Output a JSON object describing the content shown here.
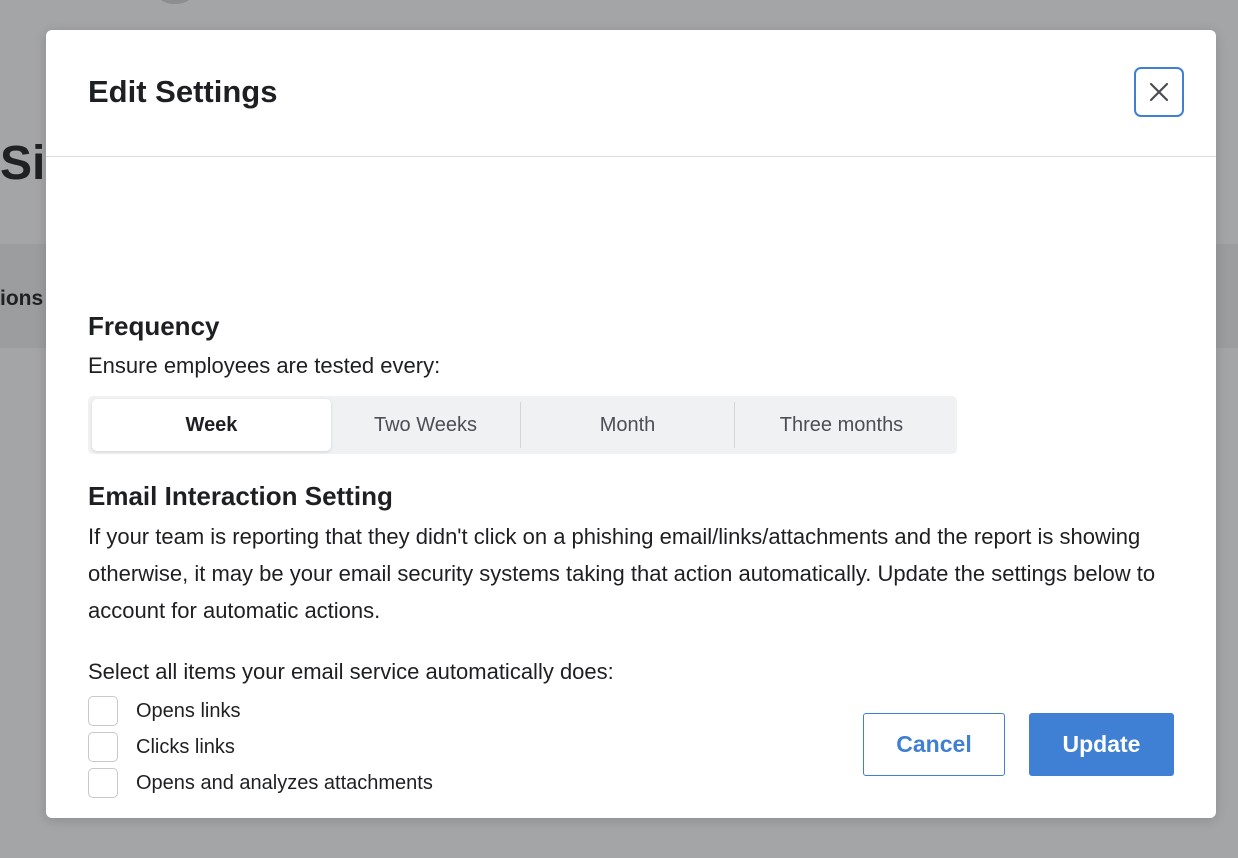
{
  "background": {
    "title_fragment": "Si",
    "band_fragment": "ions"
  },
  "modal": {
    "title": "Edit Settings",
    "close_icon": "close-icon"
  },
  "frequency": {
    "heading": "Frequency",
    "description": "Ensure employees are tested every:",
    "options": [
      {
        "label": "Week",
        "selected": true
      },
      {
        "label": "Two Weeks",
        "selected": false
      },
      {
        "label": "Month",
        "selected": false
      },
      {
        "label": "Three months",
        "selected": false
      }
    ]
  },
  "email_interaction": {
    "heading": "Email Interaction Setting",
    "description": "If your team is reporting that they didn't click on a phishing email/links/attachments and the report is showing otherwise, it may be your email security systems taking that action automatically. Update the settings below to account for automatic actions.",
    "select_prompt": "Select all items your email service automatically does:",
    "options": [
      {
        "label": "Opens links",
        "checked": false
      },
      {
        "label": "Clicks links",
        "checked": false
      },
      {
        "label": "Opens and analyzes attachments",
        "checked": false
      }
    ]
  },
  "actions": {
    "cancel_label": "Cancel",
    "update_label": "Update"
  },
  "colors": {
    "accent": "#3f7fd4",
    "overlay": "#a4a5a7",
    "segmented_bg": "#f0f1f3"
  }
}
